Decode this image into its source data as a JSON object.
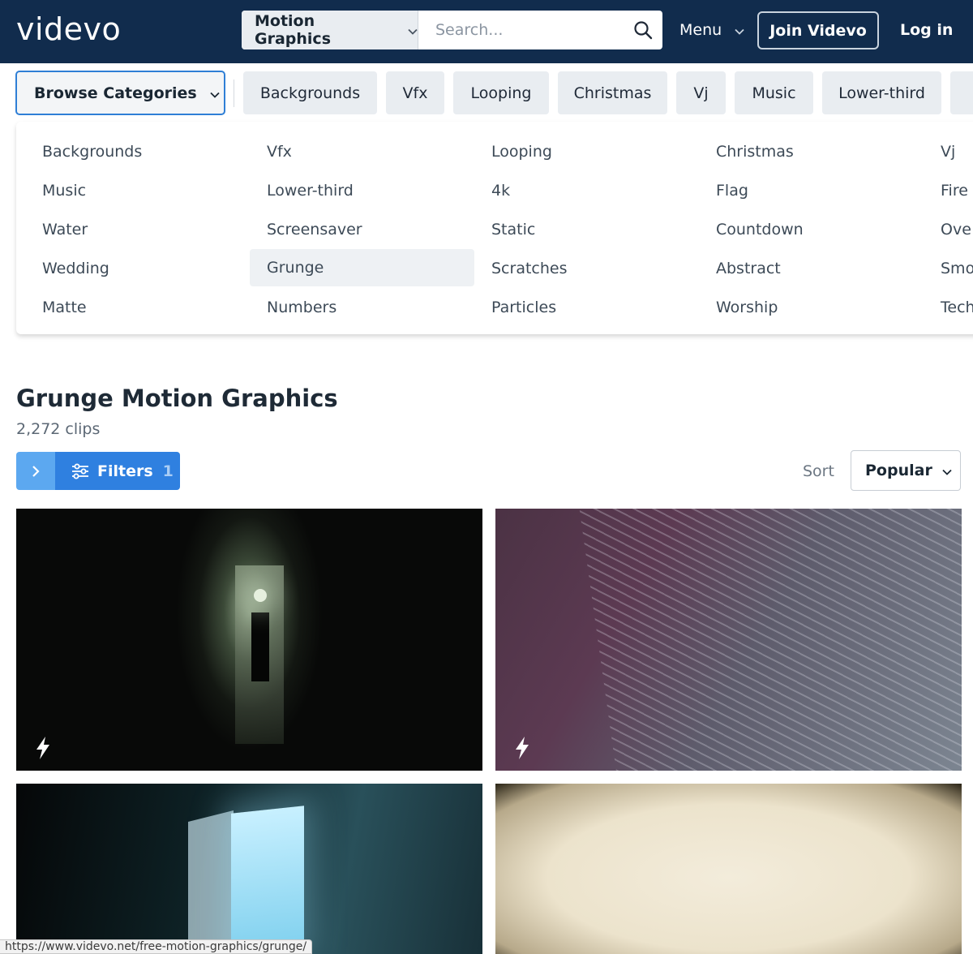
{
  "header": {
    "logo": "videvo",
    "search_type": "Motion Graphics",
    "search_placeholder": "Search...",
    "menu_label": "Menu",
    "join_label": "Join Videvo",
    "login_label": "Log in"
  },
  "browse": {
    "label": "Browse Categories",
    "chips": [
      "Backgrounds",
      "Vfx",
      "Looping",
      "Christmas",
      "Vj",
      "Music",
      "Lower-third"
    ]
  },
  "dropdown": {
    "columns": [
      [
        "Backgrounds",
        "Music",
        "Water",
        "Wedding",
        "Matte"
      ],
      [
        "Vfx",
        "Lower-third",
        "Screensaver",
        "Grunge",
        "Numbers"
      ],
      [
        "Looping",
        "4k",
        "Static",
        "Scratches",
        "Particles"
      ],
      [
        "Christmas",
        "Flag",
        "Countdown",
        "Abstract",
        "Worship"
      ],
      [
        "Vj",
        "Fire",
        "Ove",
        "Smo",
        "Tech"
      ]
    ],
    "highlighted": "Grunge"
  },
  "content": {
    "title": "Grunge Motion Graphics",
    "count": "2,272 clips",
    "filters_label": "Filters",
    "filters_count": "1",
    "sort_label": "Sort",
    "sort_value": "Popular"
  },
  "status_url": "https://www.videvo.net/free-motion-graphics/grunge/",
  "colors": {
    "header_bg": "#112c4d",
    "accent_blue": "#2f80e0",
    "light_blue": "#5ca8f0",
    "chip_bg": "#e9edf1"
  }
}
